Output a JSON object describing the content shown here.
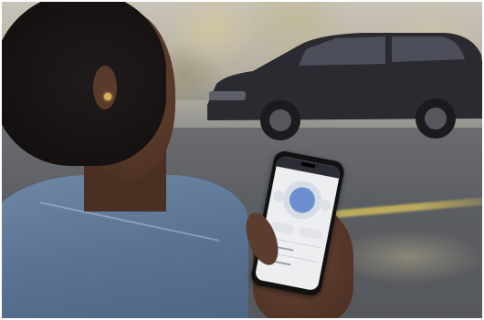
{
  "scene": {
    "subject": "",
    "colors": {
      "hair": "#141110",
      "skin": "#5a3a2a",
      "jacket": "#5a7393",
      "car": "#2b2a30",
      "road": "#5b5e62",
      "phone_screen": "#eceef0",
      "phone_dial": "#6b8fcf"
    }
  },
  "icons": {
    "earring": "earring-icon",
    "dial": "power-dial-icon"
  }
}
